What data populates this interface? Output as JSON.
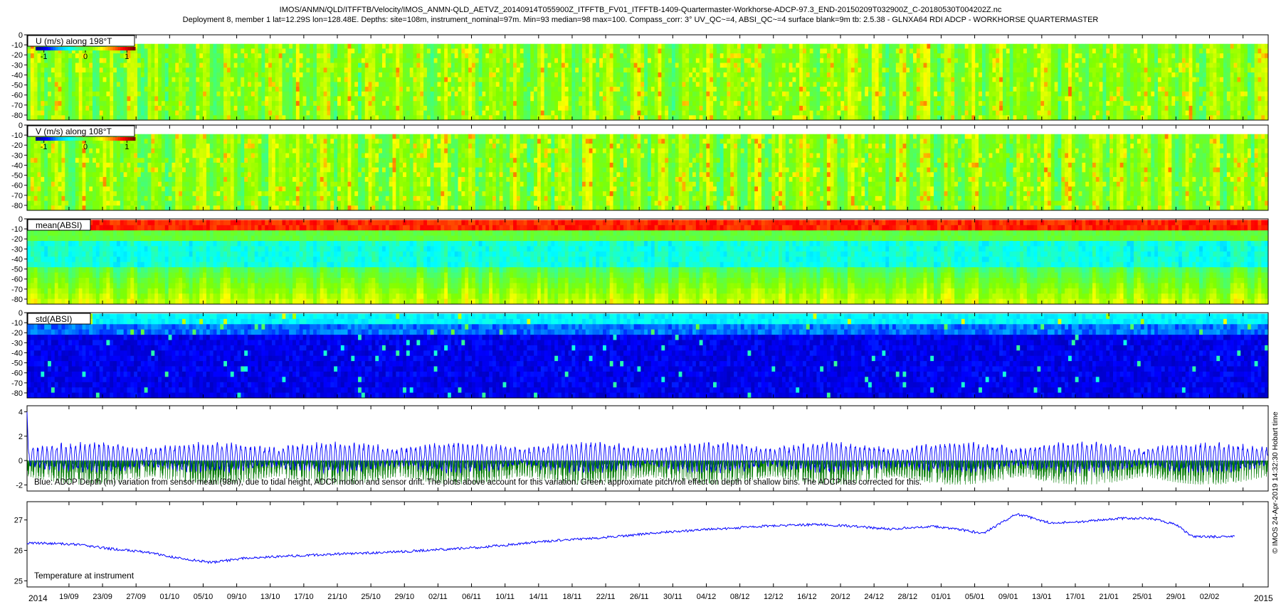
{
  "header": {
    "line1": "IMOS/ANMN/QLD/ITFFTB/Velocity/IMOS_ANMN-QLD_AETVZ_20140914T055900Z_ITFFTB_FV01_ITFFTB-1409-Quartermaster-Workhorse-ADCP-97.3_END-20150209T032900Z_C-20180530T004202Z.nc",
    "line2": "Deployment 8, member 1 lat=12.29S lon=128.48E. Depths: site=108m, instrument_nominal=97m. Min=93 median=98 max=100. Compass_corr: 3° UV_QC~=4, ABSI_QC~=4 surface blank=9m tb: 2.5.38 - GLNXA64 RDI ADCP - WORKHORSE QUARTERMASTER"
  },
  "side_stamp": "© IMOS 24-Apr-2019 14:32:30 Hobart time",
  "colors": {
    "line_blue": "#0000ff",
    "line_green": "#007a00",
    "colormap": [
      "#00008f",
      "#0000ff",
      "#00b0ff",
      "#00ffff",
      "#40ff80",
      "#80ff00",
      "#ffff00",
      "#ff8000",
      "#ff0000",
      "#800000"
    ]
  },
  "chart_data": [
    {
      "type": "heatmap",
      "label": "U (m/s) along 198°T",
      "colorbar_ticks": [
        "-1",
        "0",
        "1"
      ],
      "clim": [
        -1.2,
        1.2
      ],
      "yticks": [
        "0",
        "-10",
        "-20",
        "-30",
        "-40",
        "-50",
        "-60",
        "-70",
        "-80"
      ],
      "ylim": [
        -85,
        0
      ],
      "depth_range_m": [
        -85,
        -9
      ],
      "pattern": "tidal velocity, mostly -0.2..0.4 m/s with frequent stripes up to ~0.8"
    },
    {
      "type": "heatmap",
      "label": "V (m/s) along 108°T",
      "colorbar_ticks": [
        "-1",
        "0",
        "1"
      ],
      "clim": [
        -1.2,
        1.2
      ],
      "yticks": [
        "0",
        "-10",
        "-20",
        "-30",
        "-40",
        "-50",
        "-60",
        "-70",
        "-80"
      ],
      "ylim": [
        -85,
        0
      ],
      "depth_range_m": [
        -85,
        -9
      ],
      "pattern": "tidal velocity, mostly -0.2..0.4 m/s with stripes up to ~0.7"
    },
    {
      "type": "heatmap",
      "label": "mean(ABSI)",
      "yticks": [
        "0",
        "-10",
        "-20",
        "-30",
        "-40",
        "-50",
        "-60",
        "-70",
        "-80"
      ],
      "ylim": [
        -85,
        0
      ],
      "pattern": "high (orange-red) near the surface at -1 to -10 m, low (cyan) at -20 to -40 m, rising to green-yellow toward -85 m"
    },
    {
      "type": "heatmap",
      "label": "std(ABSI)",
      "yticks": [
        "0",
        "-10",
        "-20",
        "-30",
        "-40",
        "-50",
        "-60",
        "-70",
        "-80"
      ],
      "ylim": [
        -85,
        0
      ],
      "pattern": "cyan near the surface, dark blue below, sparse light streaks"
    },
    {
      "type": "line",
      "yticks": [
        "4",
        "2",
        "0",
        "-2"
      ],
      "ylim": [
        -2.5,
        4.5
      ],
      "annotation": "Blue: ADCP Depth (m) variation from sensor mean (98m), due to tidal height, ADCP motion and sensor drift. The plots above account for this variation. Green: approximate pitch/roll effect on depth of shallow bins. The ADCP has corrected for this.",
      "series": [
        {
          "color": "#0000ff",
          "pattern": "tidal oscillation about 0 m, amplitude ~1.5 m in a spring-neap cycle, start spike to ~4 m"
        },
        {
          "color": "#007a00",
          "pattern": "spikes from 0 down to about -2 m"
        }
      ]
    },
    {
      "type": "line",
      "label": "Temperature at instrument",
      "yticks": [
        "27",
        "26",
        "25"
      ],
      "ylim": [
        24.8,
        27.6
      ],
      "series": [
        {
          "color": "#0000ff",
          "x_days": [
            0,
            6,
            10,
            14,
            18,
            22,
            26,
            34,
            44,
            54,
            62,
            70,
            76,
            82,
            88,
            94,
            98,
            103,
            108,
            112,
            114,
            118,
            122,
            126,
            130,
            134,
            137,
            139,
            144
          ],
          "y": [
            26.25,
            26.2,
            26.05,
            25.95,
            25.75,
            25.6,
            25.75,
            25.85,
            25.95,
            26.1,
            26.3,
            26.45,
            26.6,
            26.7,
            26.8,
            26.85,
            26.8,
            26.7,
            26.8,
            26.65,
            26.55,
            27.2,
            26.9,
            26.95,
            27.05,
            27.05,
            26.85,
            26.45,
            26.45
          ]
        }
      ]
    }
  ],
  "time_axis": {
    "start_year": "2014",
    "end_year": "2015",
    "labels": [
      "19/09",
      "23/09",
      "27/09",
      "01/10",
      "05/10",
      "09/10",
      "13/10",
      "17/10",
      "21/10",
      "25/10",
      "29/10",
      "02/11",
      "06/11",
      "10/11",
      "14/11",
      "18/11",
      "22/11",
      "26/11",
      "30/11",
      "04/12",
      "08/12",
      "12/12",
      "16/12",
      "20/12",
      "24/12",
      "28/12",
      "01/01",
      "05/01",
      "09/01",
      "13/01",
      "17/01",
      "21/01",
      "25/01",
      "29/01",
      "02/02"
    ],
    "label_day_offset": 5,
    "label_day_step": 4,
    "total_days": 148
  }
}
